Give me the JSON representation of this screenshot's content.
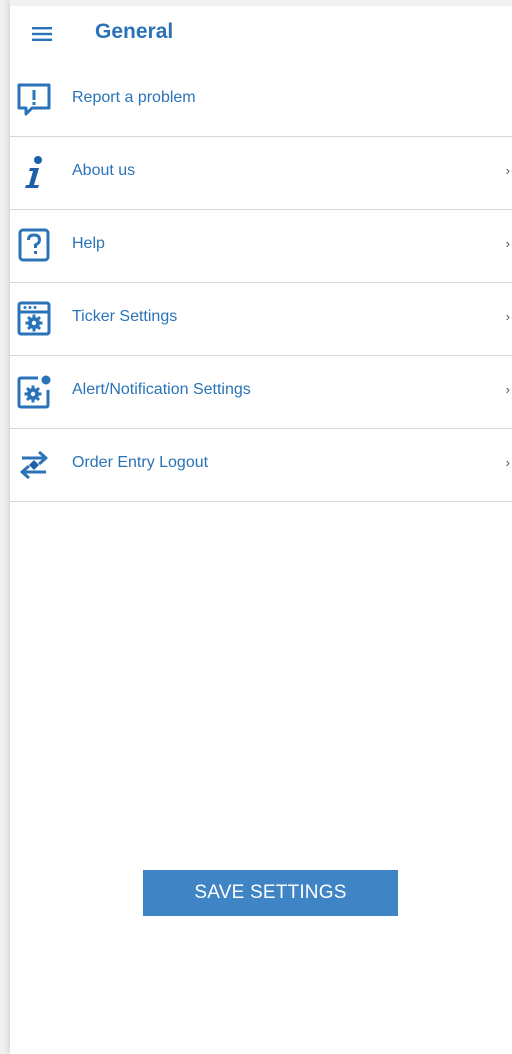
{
  "header": {
    "title": "General",
    "menu_icon": "hamburger-menu-icon"
  },
  "items": [
    {
      "label": "Report a problem",
      "icon": "report-problem-icon",
      "chevron": ""
    },
    {
      "label": "About us",
      "icon": "info-icon",
      "chevron": "›"
    },
    {
      "label": "Help",
      "icon": "help-icon",
      "chevron": "›"
    },
    {
      "label": "Ticker Settings",
      "icon": "ticker-settings-icon",
      "chevron": "›"
    },
    {
      "label": "Alert/Notification Settings",
      "icon": "alert-settings-icon",
      "chevron": "›"
    },
    {
      "label": "Order Entry Logout",
      "icon": "order-entry-logout-icon",
      "chevron": "›"
    }
  ],
  "footer": {
    "save_label": "SAVE SETTINGS"
  },
  "colors": {
    "accent": "#2a73b8",
    "button": "#3f84c5",
    "divider": "#d6d6d6"
  }
}
